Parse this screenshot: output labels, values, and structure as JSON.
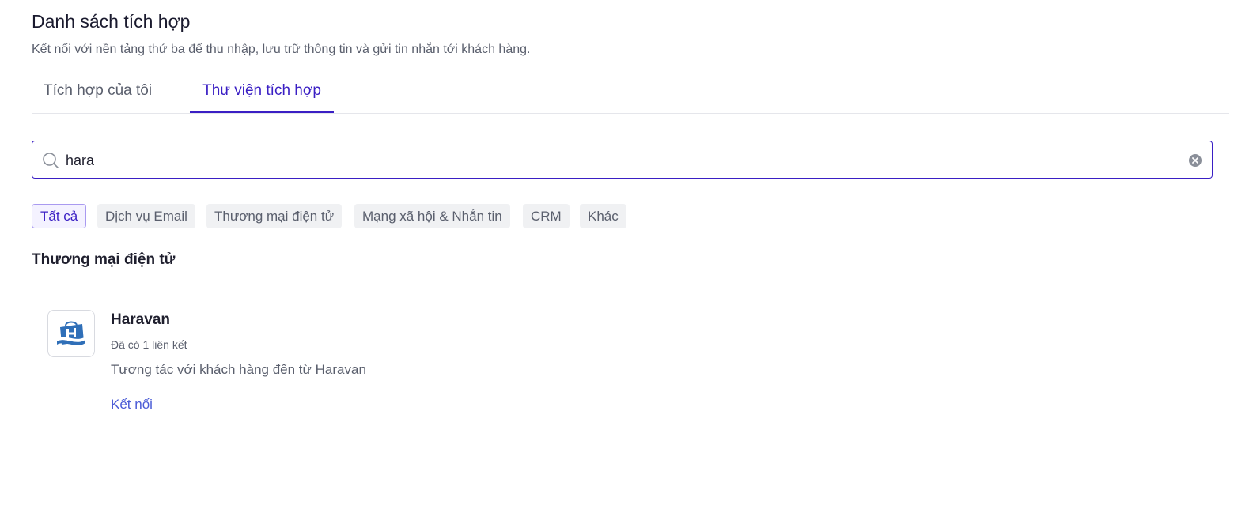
{
  "header": {
    "title": "Danh sách tích hợp",
    "subtitle": "Kết nối với nền tảng thứ ba để thu nhập, lưu trữ thông tin và gửi tin nhắn tới khách hàng."
  },
  "tabs": [
    {
      "label": "Tích hợp của tôi",
      "active": false
    },
    {
      "label": "Thư viện tích hợp",
      "active": true
    }
  ],
  "search": {
    "value": "hara",
    "icon": "search-icon",
    "clear_icon": "clear-icon"
  },
  "filters": [
    {
      "label": "Tất cả",
      "active": true
    },
    {
      "label": "Dịch vụ Email",
      "active": false
    },
    {
      "label": "Thương mại điện tử",
      "active": false
    },
    {
      "label": "Mạng xã hội & Nhắn tin",
      "active": false
    },
    {
      "label": "CRM",
      "active": false
    },
    {
      "label": "Khác",
      "active": false
    }
  ],
  "section": {
    "title": "Thương mại điện tử"
  },
  "integrations": [
    {
      "name": "Haravan",
      "logo": "haravan-logo",
      "linked": "Đã có 1 liên kết",
      "description": "Tương tác với khách hàng đến từ Haravan",
      "action": "Kết nối"
    }
  ],
  "colors": {
    "accent": "#3a1fc4",
    "link": "#4a5bd6",
    "muted_text": "#5a5f6d",
    "chip_bg": "#f0f1f3"
  }
}
